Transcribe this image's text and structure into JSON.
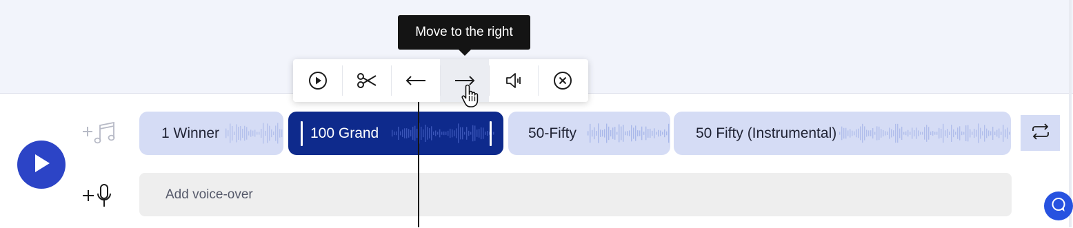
{
  "tooltip": {
    "text": "Move to the right"
  },
  "toolbar": {
    "tools": [
      {
        "name": "play",
        "icon": "play-circle-icon"
      },
      {
        "name": "cut",
        "icon": "scissors-icon"
      },
      {
        "name": "move-left",
        "icon": "arrow-left-icon"
      },
      {
        "name": "move-right",
        "icon": "arrow-right-icon",
        "active": true
      },
      {
        "name": "volume",
        "icon": "speaker-icon"
      },
      {
        "name": "delete",
        "icon": "close-circle-icon"
      }
    ]
  },
  "music_track": {
    "clips": [
      {
        "label": "1 Winner",
        "selected": false
      },
      {
        "label": "100 Grand",
        "selected": true
      },
      {
        "label": "50-Fifty",
        "selected": false
      },
      {
        "label": "50 Fifty (Instrumental)",
        "selected": false
      }
    ]
  },
  "voice_track": {
    "placeholder": "Add voice-over"
  },
  "colors": {
    "accent": "#2c44c6",
    "selected_clip": "#0e2a8c",
    "clip": "#d5dcf5",
    "wave": "#9fb0e8",
    "tooltip_bg": "#141414"
  }
}
